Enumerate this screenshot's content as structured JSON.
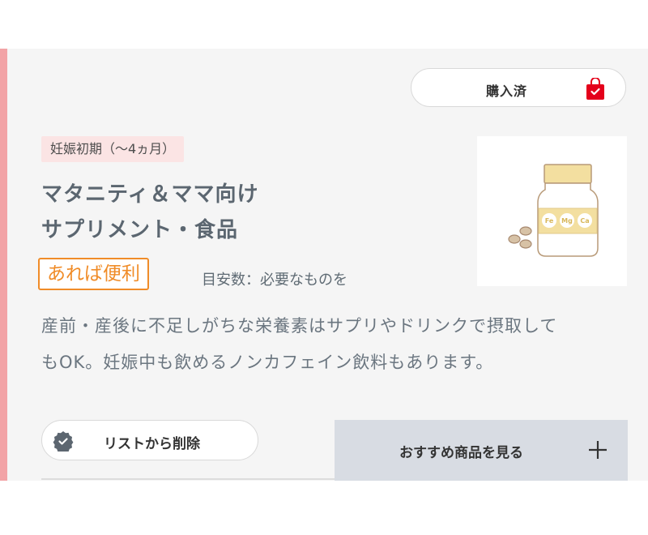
{
  "item": {
    "purchased_label": "購入済",
    "period_tag": "妊娠初期（〜4ヵ月）",
    "title_line1": "マタニティ＆ママ向け",
    "title_line2": "サプリメント・食品",
    "badge": "あれば便利",
    "quantity": "目安数：必要なものを",
    "description_line1": "産前・産後に不足しがちな栄養素はサプリやドリンクで摂取して",
    "description_line2": "もOK。妊娠中も飲めるノンカフェイン飲料もあります。",
    "image_labels": [
      "Fe",
      "Mg",
      "Ca"
    ]
  },
  "actions": {
    "remove_label": "リストから削除",
    "recommend_label": "おすすめ商品を見る"
  },
  "colors": {
    "accent_pink": "#f2a3a6",
    "badge_orange": "#f08c28",
    "bag_red": "#e4001b",
    "tag_bg": "#fbe4e4",
    "recommend_bg": "#d8dce3"
  },
  "icons": {
    "purchased": "shopping-bag-icon",
    "remove": "check-circle-icon",
    "recommend": "plus-icon"
  }
}
